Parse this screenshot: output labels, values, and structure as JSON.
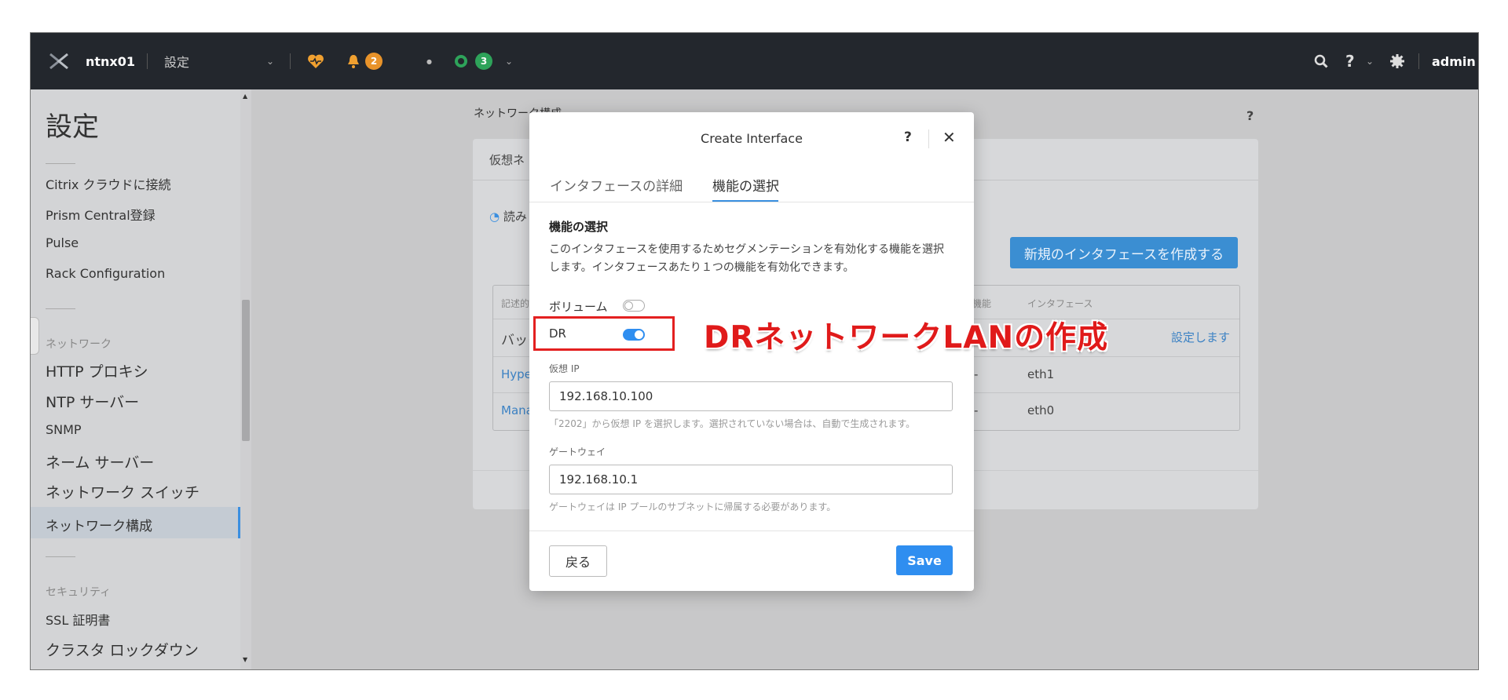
{
  "topbar": {
    "cluster_name": "ntnx01",
    "menu_label": "設定",
    "alert_count": "2",
    "task_count": "3",
    "user": "admin"
  },
  "sidebar": {
    "title": "設定",
    "items_top": [
      "Citrix クラウドに接続",
      "Prism Central登録",
      "Pulse",
      "Rack Configuration"
    ],
    "network_header": "ネットワーク",
    "network_items": [
      "HTTP プロキシ",
      "NTP サーバー",
      "SNMP",
      "ネーム サーバー",
      "ネットワーク スイッチ",
      "ネットワーク構成"
    ],
    "security_header": "セキュリティ",
    "security_items": [
      "SSL 証明書",
      "クラスタ ロックダウン"
    ]
  },
  "background": {
    "title": "ネットワーク構成",
    "help": "?",
    "panel_tab": "仮想ネ",
    "loading": "読み",
    "create_button": "新規のインタフェースを作成する",
    "table_headers": [
      "記述的",
      "機能",
      "インタフェース"
    ],
    "rows": [
      {
        "name": "バック",
        "feature": "",
        "interface": "",
        "action": "設定します"
      },
      {
        "name": "Hype",
        "feature": "-",
        "interface": "eth1",
        "action": ""
      },
      {
        "name": "Mana",
        "feature": "-",
        "interface": "eth0",
        "action": ""
      }
    ]
  },
  "modal": {
    "title": "Create Interface",
    "help": "?",
    "close": "✕",
    "tabs": [
      "インタフェースの詳細",
      "機能の選択"
    ],
    "section_title": "機能の選択",
    "description": "このインタフェースを使用するためセグメンテーションを有効化する機能を選択します。インタフェースあたり１つの機能を有効化できます。",
    "features": [
      {
        "label": "ボリューム",
        "enabled": false
      },
      {
        "label": "DR",
        "enabled": true
      }
    ],
    "virtual_ip_label": "仮想 IP",
    "virtual_ip_value": "192.168.10.100",
    "virtual_ip_hint": "「2202」から仮想 IP を選択します。選択されていない場合は、自動で生成されます。",
    "gateway_label": "ゲートウェイ",
    "gateway_value": "192.168.10.1",
    "gateway_hint": "ゲートウェイは IP プールのサブネットに帰属する必要があります。",
    "back_button": "戻る",
    "save_button": "Save"
  },
  "annotation": {
    "text": "DRネットワークLANの作成",
    "color": "#e01a1a"
  },
  "colors": {
    "accent": "#2f8ef0",
    "topbar": "#23272d",
    "alert_badge": "#e8932a",
    "task_badge": "#2ea35a"
  }
}
